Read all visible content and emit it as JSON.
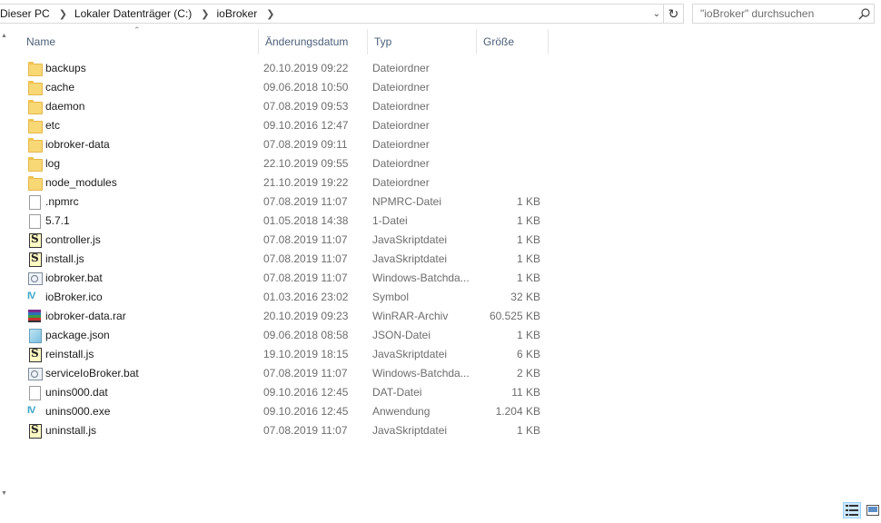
{
  "breadcrumb": [
    "Dieser PC",
    "Lokaler Datenträger (C:)",
    "ioBroker"
  ],
  "search": {
    "placeholder": "\"ioBroker\" durchsuchen"
  },
  "columns": {
    "name": "Name",
    "date": "Änderungsdatum",
    "type": "Typ",
    "size": "Größe"
  },
  "files": [
    {
      "name": "backups",
      "date": "20.10.2019 09:22",
      "type": "Dateiordner",
      "size": "",
      "icon": "folder-icon"
    },
    {
      "name": "cache",
      "date": "09.06.2018 10:50",
      "type": "Dateiordner",
      "size": "",
      "icon": "folder-icon"
    },
    {
      "name": "daemon",
      "date": "07.08.2019 09:53",
      "type": "Dateiordner",
      "size": "",
      "icon": "folder-icon"
    },
    {
      "name": "etc",
      "date": "09.10.2016 12:47",
      "type": "Dateiordner",
      "size": "",
      "icon": "folder-icon"
    },
    {
      "name": "iobroker-data",
      "date": "07.08.2019 09:11",
      "type": "Dateiordner",
      "size": "",
      "icon": "folder-icon"
    },
    {
      "name": "log",
      "date": "22.10.2019 09:55",
      "type": "Dateiordner",
      "size": "",
      "icon": "folder-icon"
    },
    {
      "name": "node_modules",
      "date": "21.10.2019 19:22",
      "type": "Dateiordner",
      "size": "",
      "icon": "folder-icon"
    },
    {
      "name": ".npmrc",
      "date": "07.08.2019 11:07",
      "type": "NPMRC-Datei",
      "size": "1 KB",
      "icon": "file-icon"
    },
    {
      "name": "5.7.1",
      "date": "01.05.2018 14:38",
      "type": "1-Datei",
      "size": "1 KB",
      "icon": "file-icon"
    },
    {
      "name": "controller.js",
      "date": "07.08.2019 11:07",
      "type": "JavaSkriptdatei",
      "size": "1 KB",
      "icon": "javascript-file-icon"
    },
    {
      "name": "install.js",
      "date": "07.08.2019 11:07",
      "type": "JavaSkriptdatei",
      "size": "1 KB",
      "icon": "javascript-file-icon"
    },
    {
      "name": "iobroker.bat",
      "date": "07.08.2019 11:07",
      "type": "Windows-Batchda...",
      "size": "1 KB",
      "icon": "batch-file-icon"
    },
    {
      "name": "ioBroker.ico",
      "date": "01.03.2016 23:02",
      "type": "Symbol",
      "size": "32 KB",
      "icon": "iobroker-icon"
    },
    {
      "name": "iobroker-data.rar",
      "date": "20.10.2019 09:23",
      "type": "WinRAR-Archiv",
      "size": "60.525 KB",
      "icon": "winrar-archive-icon"
    },
    {
      "name": "package.json",
      "date": "09.06.2018 08:58",
      "type": "JSON-Datei",
      "size": "1 KB",
      "icon": "json-file-icon"
    },
    {
      "name": "reinstall.js",
      "date": "19.10.2019 18:15",
      "type": "JavaSkriptdatei",
      "size": "6 KB",
      "icon": "javascript-file-icon"
    },
    {
      "name": "serviceIoBroker.bat",
      "date": "07.08.2019 11:07",
      "type": "Windows-Batchda...",
      "size": "2 KB",
      "icon": "batch-file-icon"
    },
    {
      "name": "unins000.dat",
      "date": "09.10.2016 12:45",
      "type": "DAT-Datei",
      "size": "11 KB",
      "icon": "file-icon"
    },
    {
      "name": "unins000.exe",
      "date": "09.10.2016 12:45",
      "type": "Anwendung",
      "size": "1.204 KB",
      "icon": "iobroker-icon"
    },
    {
      "name": "uninstall.js",
      "date": "07.08.2019 11:07",
      "type": "JavaSkriptdatei",
      "size": "1 KB",
      "icon": "javascript-file-icon"
    }
  ],
  "view": {
    "active": "details"
  }
}
